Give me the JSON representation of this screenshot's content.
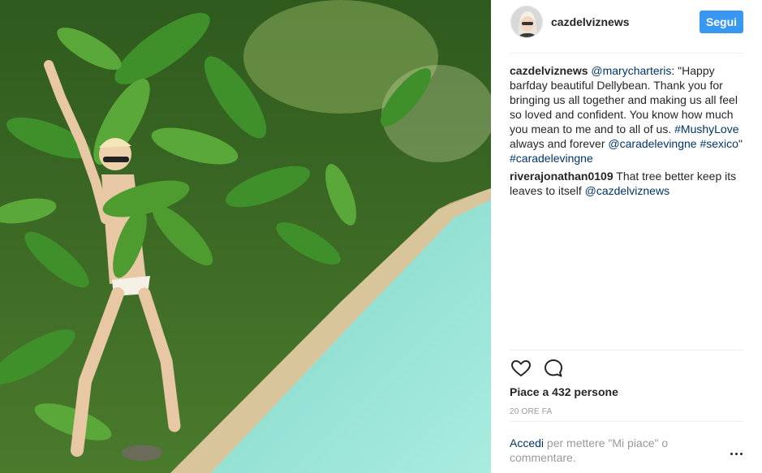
{
  "header": {
    "username": "cazdelviznews",
    "follow_label": "Segui"
  },
  "caption": {
    "user": "cazdelviznews",
    "mention_1": "@marycharteris",
    "text_1": ": \"Happy barfday beautiful Dellybean. Thank you for bringing us all together and making us all feel so loved and confident. You know how much you mean to me and to all of us. ",
    "hashtag_1": "#MushyLove",
    "text_2": " always and forever ",
    "mention_2": "@caradelevingne",
    "text_3": " ",
    "hashtag_2": "#sexico",
    "text_4": "\" ",
    "hashtag_3": "#caradelevingne"
  },
  "comment": {
    "user": "riverajonathan0109",
    "text": " That tree better keep its leaves to itself ",
    "mention": "@cazdelviznews"
  },
  "actions": {
    "like_icon": "heart-icon",
    "comment_icon": "comment-bubble-icon"
  },
  "likes_text": "Piace a 432 persone",
  "timestamp": "20 ORE FA",
  "login": {
    "link": "Accedi",
    "text": " per mettere \"Mi piace\" o commentare."
  },
  "more_icon": "more-options-icon",
  "colors": {
    "follow_button": "#3897f0",
    "link": "#003569",
    "muted": "#999999"
  }
}
